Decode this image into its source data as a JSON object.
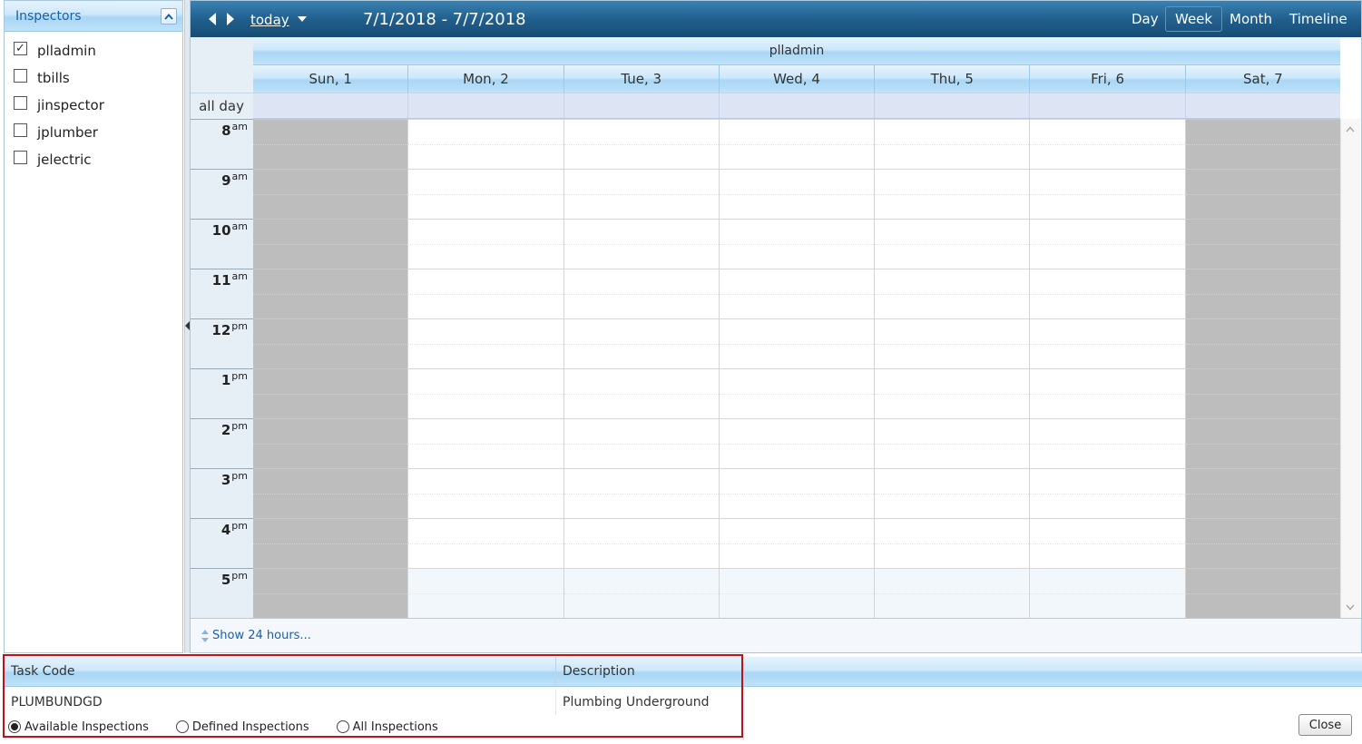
{
  "inspectors_panel": {
    "title": "Inspectors",
    "items": [
      {
        "label": "plladmin",
        "checked": true
      },
      {
        "label": "tbills",
        "checked": false
      },
      {
        "label": "jinspector",
        "checked": false
      },
      {
        "label": "jplumber",
        "checked": false
      },
      {
        "label": "jelectric",
        "checked": false
      }
    ]
  },
  "toolbar": {
    "today_label": "today",
    "date_range": "7/1/2018 - 7/7/2018",
    "views": [
      "Day",
      "Week",
      "Month",
      "Timeline"
    ],
    "active_view": "Week"
  },
  "calendar": {
    "resource": "plladmin",
    "days": [
      "Sun, 1",
      "Mon, 2",
      "Tue, 3",
      "Wed, 4",
      "Thu, 5",
      "Fri, 6",
      "Sat, 7"
    ],
    "all_day_label": "all day",
    "hours": [
      {
        "h": "8",
        "ampm": "am"
      },
      {
        "h": "9",
        "ampm": "am"
      },
      {
        "h": "10",
        "ampm": "am"
      },
      {
        "h": "11",
        "ampm": "am"
      },
      {
        "h": "12",
        "ampm": "pm"
      },
      {
        "h": "1",
        "ampm": "pm"
      },
      {
        "h": "2",
        "ampm": "pm"
      },
      {
        "h": "3",
        "ampm": "pm"
      },
      {
        "h": "4",
        "ampm": "pm"
      },
      {
        "h": "5",
        "ampm": "pm"
      }
    ],
    "show_24_label": "Show 24 hours..."
  },
  "task_grid": {
    "columns": [
      "Task Code",
      "Description"
    ],
    "rows": [
      {
        "code": "PLUMBUNDGD",
        "description": "Plumbing Underground"
      }
    ],
    "filter_options": [
      {
        "label": "Available Inspections",
        "selected": true
      },
      {
        "label": "Defined Inspections",
        "selected": false
      },
      {
        "label": "All Inspections",
        "selected": false
      }
    ]
  },
  "close_label": "Close",
  "colors": {
    "toolbar_top": "#3a82b3",
    "toolbar_bottom": "#174c74",
    "weekend_shade": "#bdbdbd",
    "highlight_border": "#c0101a",
    "link_blue": "#1a5fa8"
  }
}
